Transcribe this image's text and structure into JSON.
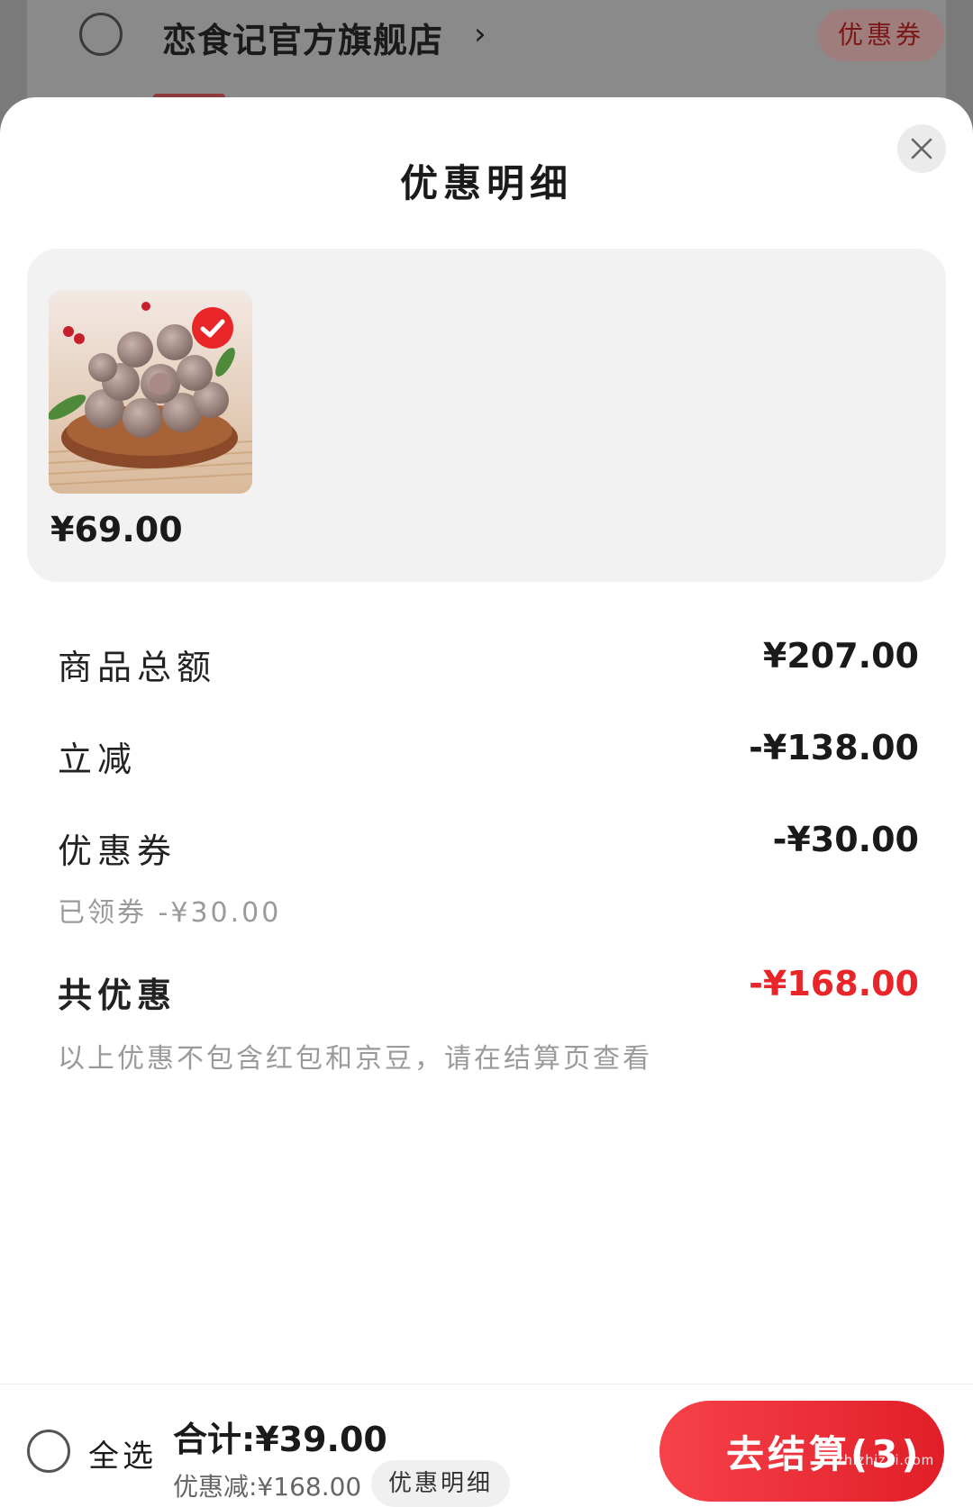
{
  "background": {
    "store_name": "恋食记官方旗舰店",
    "chevron": "›",
    "coupon_tag": "优惠券"
  },
  "sheet": {
    "title": "优惠明细",
    "close_icon": "close-icon"
  },
  "product": {
    "price": "¥69.00",
    "image_description_icon": "product-thumbnail"
  },
  "details": {
    "goods_total_label": "商品总额",
    "goods_total_value": "¥207.00",
    "instant_discount_label": "立减",
    "instant_discount_value": "-¥138.00",
    "coupon_label": "优惠券",
    "coupon_value": "-¥30.00",
    "coupon_sub": "已领券 -¥30.00",
    "total_discount_label": "共优惠",
    "total_discount_value": "-¥168.00",
    "note": "以上优惠不包含红包和京豆，请在结算页查看"
  },
  "bottom_bar": {
    "select_all_label": "全选",
    "total_text": "合计:¥39.00",
    "discount_text": "优惠减:¥168.00",
    "detail_button_label": "优惠明细",
    "checkout_label": "去结算(3)",
    "watermark": "zhizhizhi.com"
  },
  "colors": {
    "accent_red": "#e8262a",
    "checkout_gradient_start": "#f7424a",
    "checkout_gradient_end": "#e01e28"
  }
}
